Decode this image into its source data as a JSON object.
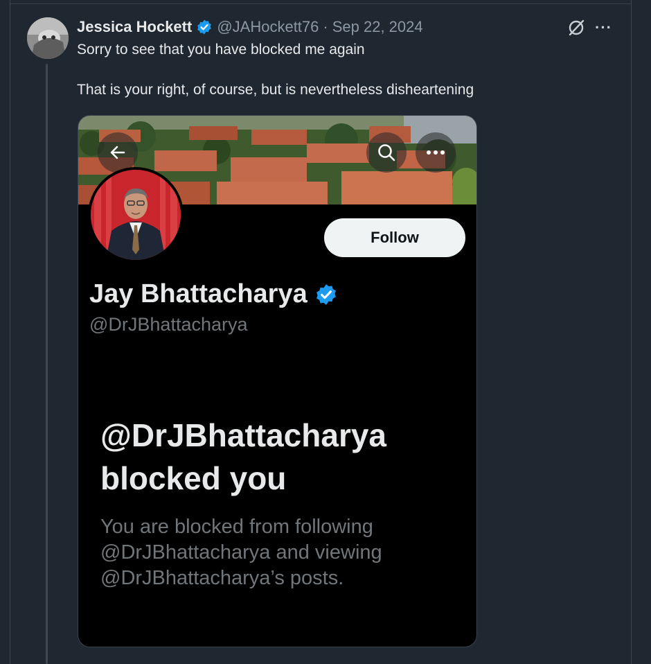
{
  "tweet": {
    "display_name": "Jessica Hockett",
    "handle": "@JAHockett76",
    "separator": "·",
    "date": "Sep 22, 2024",
    "more_label": "···",
    "lines": [
      "Sorry to see that you have blocked me again",
      "That is your right, of course, but is nevertheless disheartening"
    ]
  },
  "embedded_screenshot": {
    "profile_name": "Jay Bhattacharya",
    "profile_handle": "@DrJBhattacharya",
    "follow_label": "Follow",
    "blocked_title_line1": "@DrJBhattacharya",
    "blocked_title_line2": "blocked you",
    "blocked_desc_line1": "You are blocked from following",
    "blocked_desc_line2": "@DrJBhattacharya and viewing",
    "blocked_desc_line3": "@DrJBhattacharya’s posts."
  },
  "icons": {
    "verified": "verified-badge-icon",
    "grok": "grok-icon",
    "more": "more-icon",
    "back": "back-arrow-icon",
    "search": "search-icon",
    "overflow": "overflow-menu-icon"
  },
  "colors": {
    "background": "#1f2731",
    "verified_blue": "#1d9bf0",
    "muted_text": "#8b98a5",
    "follow_bg": "#eff3f4"
  }
}
